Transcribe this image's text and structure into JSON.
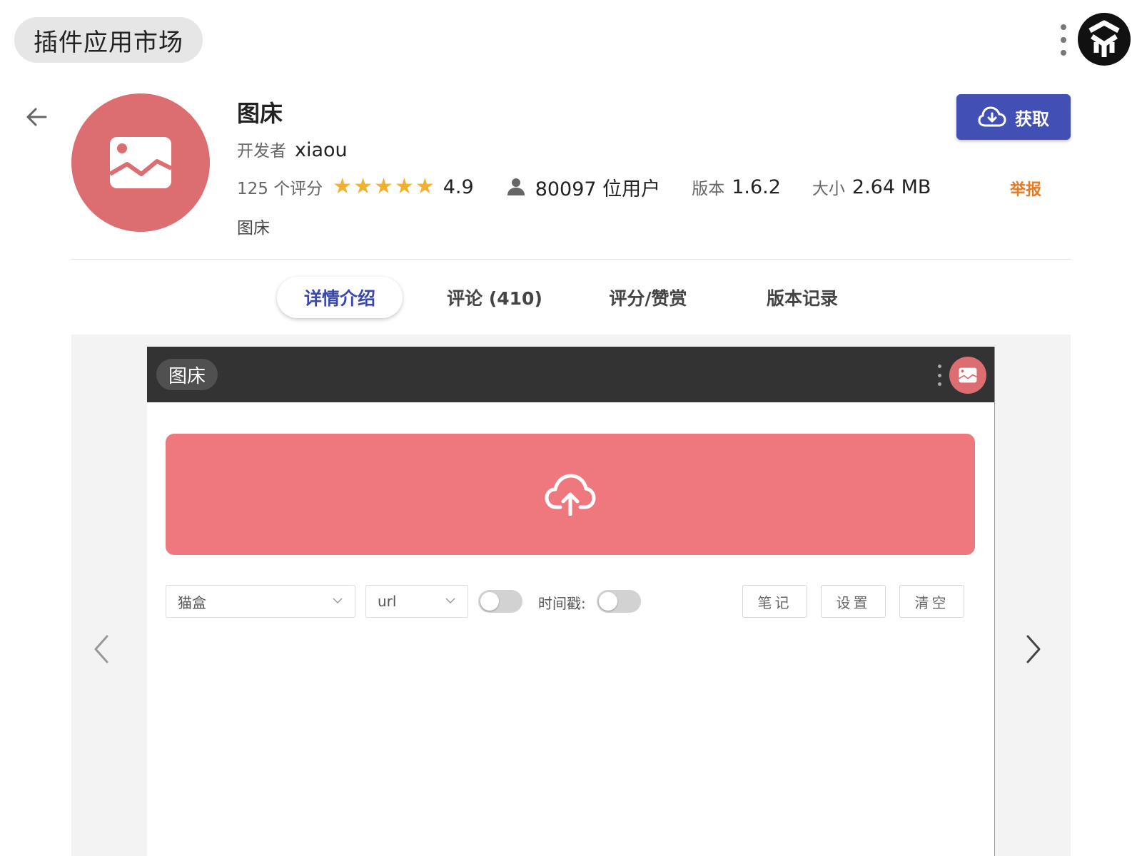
{
  "app": {
    "title": "插件应用市场"
  },
  "plugin": {
    "name": "图床",
    "developer_label": "开发者",
    "developer": "xiaou",
    "rating_count": "125 个评分",
    "rating_value": "4.9",
    "rating_stars": 5,
    "users": "80097 位用户",
    "version_label": "版本",
    "version": "1.6.2",
    "size_label": "大小",
    "size": "2.64 MB",
    "description": "图床",
    "icon": "image-icon",
    "icon_color": "#dc6e72"
  },
  "actions": {
    "get_label": "获取",
    "report_label": "举报",
    "primary_color": "#4250b5",
    "report_color": "#e07b2a"
  },
  "tabs": [
    {
      "label": "详情介绍",
      "active": true
    },
    {
      "label": "评论 (410)",
      "active": false
    },
    {
      "label": "评分/赞赏",
      "active": false
    },
    {
      "label": "版本记录",
      "active": false
    }
  ],
  "screenshot": {
    "title": "图床",
    "upload_color": "#ee787e",
    "host_select": "猫盒",
    "format_select": "url",
    "timestamp_label": "时间戳:",
    "toggle1_on": false,
    "toggle2_on": false,
    "buttons": [
      "笔记",
      "设置",
      "清空"
    ]
  }
}
